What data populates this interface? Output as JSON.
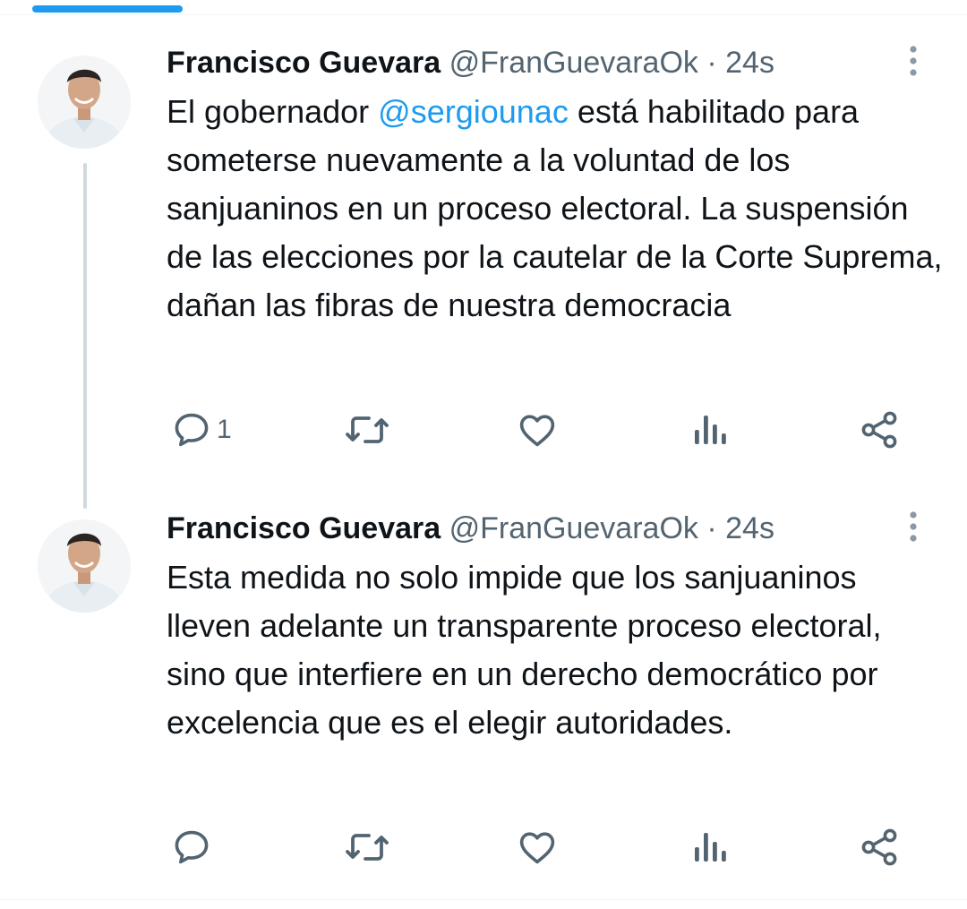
{
  "tweets": [
    {
      "display_name": "Francisco Guevara",
      "handle": "@FranGuevaraOk",
      "separator": "·",
      "timestamp": "24s",
      "text_before_mention": "El gobernador ",
      "mention": "@sergiounac",
      "text_after_mention": " está habilitado para someterse nuevamente a la voluntad de los sanjuaninos en un proceso electoral. La suspensión de las elecciones por la cautelar de la Corte Suprema, dañan las fibras de nuestra democracia",
      "reply_count": "1",
      "icons": [
        "reply-icon",
        "retweet-icon",
        "like-icon",
        "views-icon",
        "share-icon",
        "more-vertical-icon"
      ]
    },
    {
      "display_name": "Francisco Guevara",
      "handle": "@FranGuevaraOk",
      "separator": "·",
      "timestamp": "24s",
      "text": "Esta medida no solo impide que los sanjuaninos lleven adelante un transparente proceso electoral, sino que interfiere en un derecho democrático por excelencia que es el elegir autoridades.",
      "reply_count": "",
      "icons": [
        "reply-icon",
        "retweet-icon",
        "like-icon",
        "views-icon",
        "share-icon",
        "more-vertical-icon"
      ]
    }
  ],
  "colors": {
    "accent": "#1d9bf0",
    "text": "#0f1419",
    "secondary_text": "#536471",
    "thread_line": "#cfd9de",
    "divider": "#eff3f4"
  }
}
